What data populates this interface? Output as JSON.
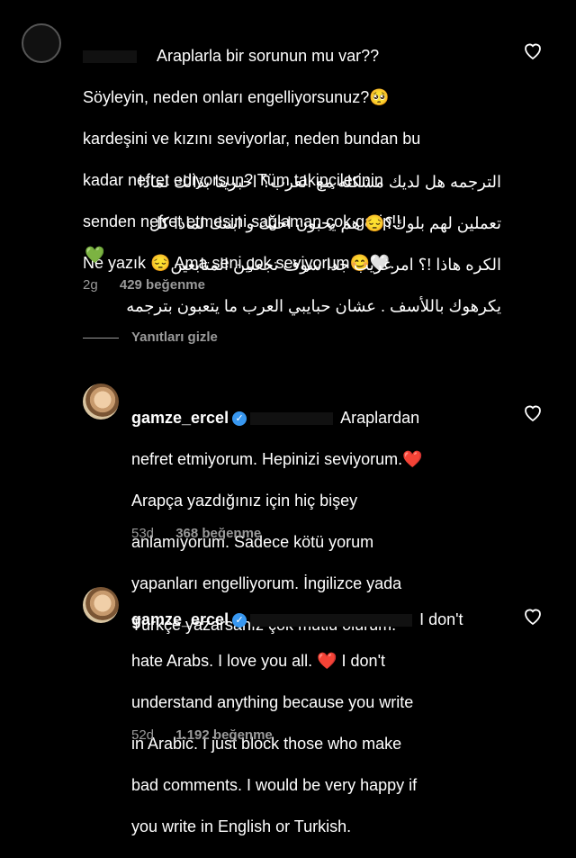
{
  "comment1": {
    "lines_tr": [
      "Araplarla bir sorunun mu var??",
      "Söyleyin, neden onları engelliyorsunuz?🥺",
      "kardeşini ve kızını seviyorlar, neden bundan bu",
      "kadar nefret  ediyorsun? Tüm takipçilerinin",
      "senden nefret etmesini sağlaman çok garip!!",
      "Ne yazık 😔  Ama seni çok seviyorum😊🤍."
    ],
    "lines_ar": [
      "الترجمه  هل لديك مشكله مع العرب؟ اخبرينا بذالك لماذا",
      "تعملين لهم بلوك؟😔  هم يحبون اختك و ابنتك لماذا كل",
      "الكره هاذا !؟ امرغريب جدا سوف تجعلين المتابعين",
      "يكرهوك باللأسف . عشان حبايبي العرب ما يتعبون بترجمه"
    ],
    "trailing_emoji": "💚",
    "time_ago": "2g",
    "likes": "429 beğenme"
  },
  "hide_replies": "Yanıtları gizle",
  "reply1": {
    "username": "gamze_ercel",
    "first_line": "Araplardan",
    "lines": [
      "nefret etmiyorum. Hepinizi seviyorum.❤️",
      "Arapça yazdığınız için hiç bişey",
      "anlamıyorum. Sadece kötü yorum",
      "yapanları engelliyorum. İngilizce yada",
      "Türkçe yazarsanız çok mutlu olurum."
    ],
    "time_ago": "53d",
    "likes": "368 beğenme"
  },
  "reply2": {
    "username": "gamze_ercel",
    "first_line": "I don't",
    "lines": [
      "hate Arabs.  I love you all. ❤️ I don't",
      "understand anything because you write",
      "in Arabic.  I just block those who make",
      "bad comments.  I would be very happy if",
      "you write in English or Turkish."
    ],
    "time_ago": "52d",
    "likes": "1.192 beğenme"
  },
  "colors": {
    "verified": "#3897f0",
    "meta": "#9a9a9a",
    "heart_red": "#e0245e"
  }
}
